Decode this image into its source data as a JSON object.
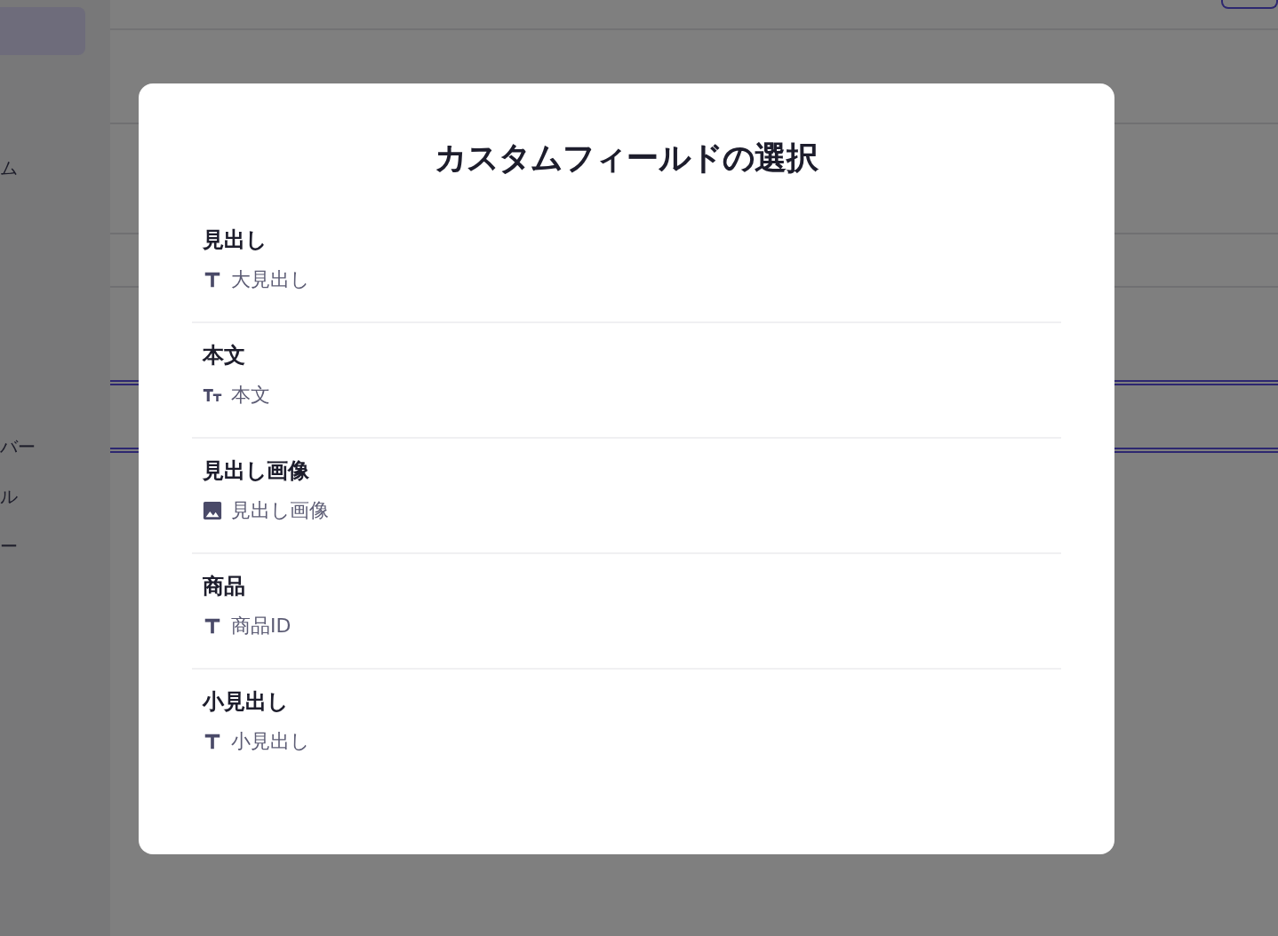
{
  "background": {
    "sidebar_items": [
      "ム",
      "バー",
      "ル",
      "ー"
    ]
  },
  "dialog": {
    "title": "カスタムフィールドの選択",
    "fields": [
      {
        "name": "見出し",
        "kind": "text",
        "type_label": "大見出し"
      },
      {
        "name": "本文",
        "kind": "richtext",
        "type_label": "本文"
      },
      {
        "name": "見出し画像",
        "kind": "image",
        "type_label": "見出し画像"
      },
      {
        "name": "商品",
        "kind": "text",
        "type_label": "商品ID"
      },
      {
        "name": "小見出し",
        "kind": "text",
        "type_label": "小見出し"
      }
    ]
  }
}
